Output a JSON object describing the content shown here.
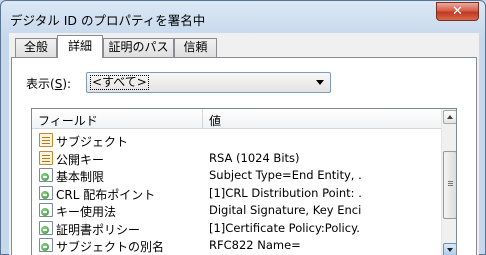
{
  "window": {
    "title": "デジタル ID のプロパティを署名中",
    "close_label": "✕"
  },
  "tabs": [
    {
      "label": "全般",
      "active": false
    },
    {
      "label": "詳細",
      "active": true
    },
    {
      "label": "証明のパス",
      "active": false
    },
    {
      "label": "信頼",
      "active": false
    }
  ],
  "show": {
    "label_prefix": "表示(",
    "label_key": "S",
    "label_suffix": "):",
    "selected": "<すべて>"
  },
  "list": {
    "columns": {
      "field": "フィールド",
      "value": "値"
    },
    "rows": [
      {
        "icon": "certificate-field-icon",
        "field": "サブジェクト",
        "value": ""
      },
      {
        "icon": "certificate-field-icon",
        "field": "公開キー",
        "value": "RSA (1024 Bits)"
      },
      {
        "icon": "certificate-extension-icon",
        "field": "基本制限",
        "value": "Subject Type=End Entity, ..."
      },
      {
        "icon": "certificate-extension-icon",
        "field": "CRL 配布ポイント",
        "value": "[1]CRL Distribution Point: ..."
      },
      {
        "icon": "certificate-extension-icon",
        "field": "キー使用法",
        "value": "Digital Signature, Key Enci..."
      },
      {
        "icon": "certificate-extension-icon",
        "field": "証明書ポリシー",
        "value": "[1]Certificate Policy:Policy..."
      },
      {
        "icon": "certificate-extension-icon",
        "field": "サブジェクトの別名",
        "value": "RFC822 Name="
      }
    ]
  }
}
